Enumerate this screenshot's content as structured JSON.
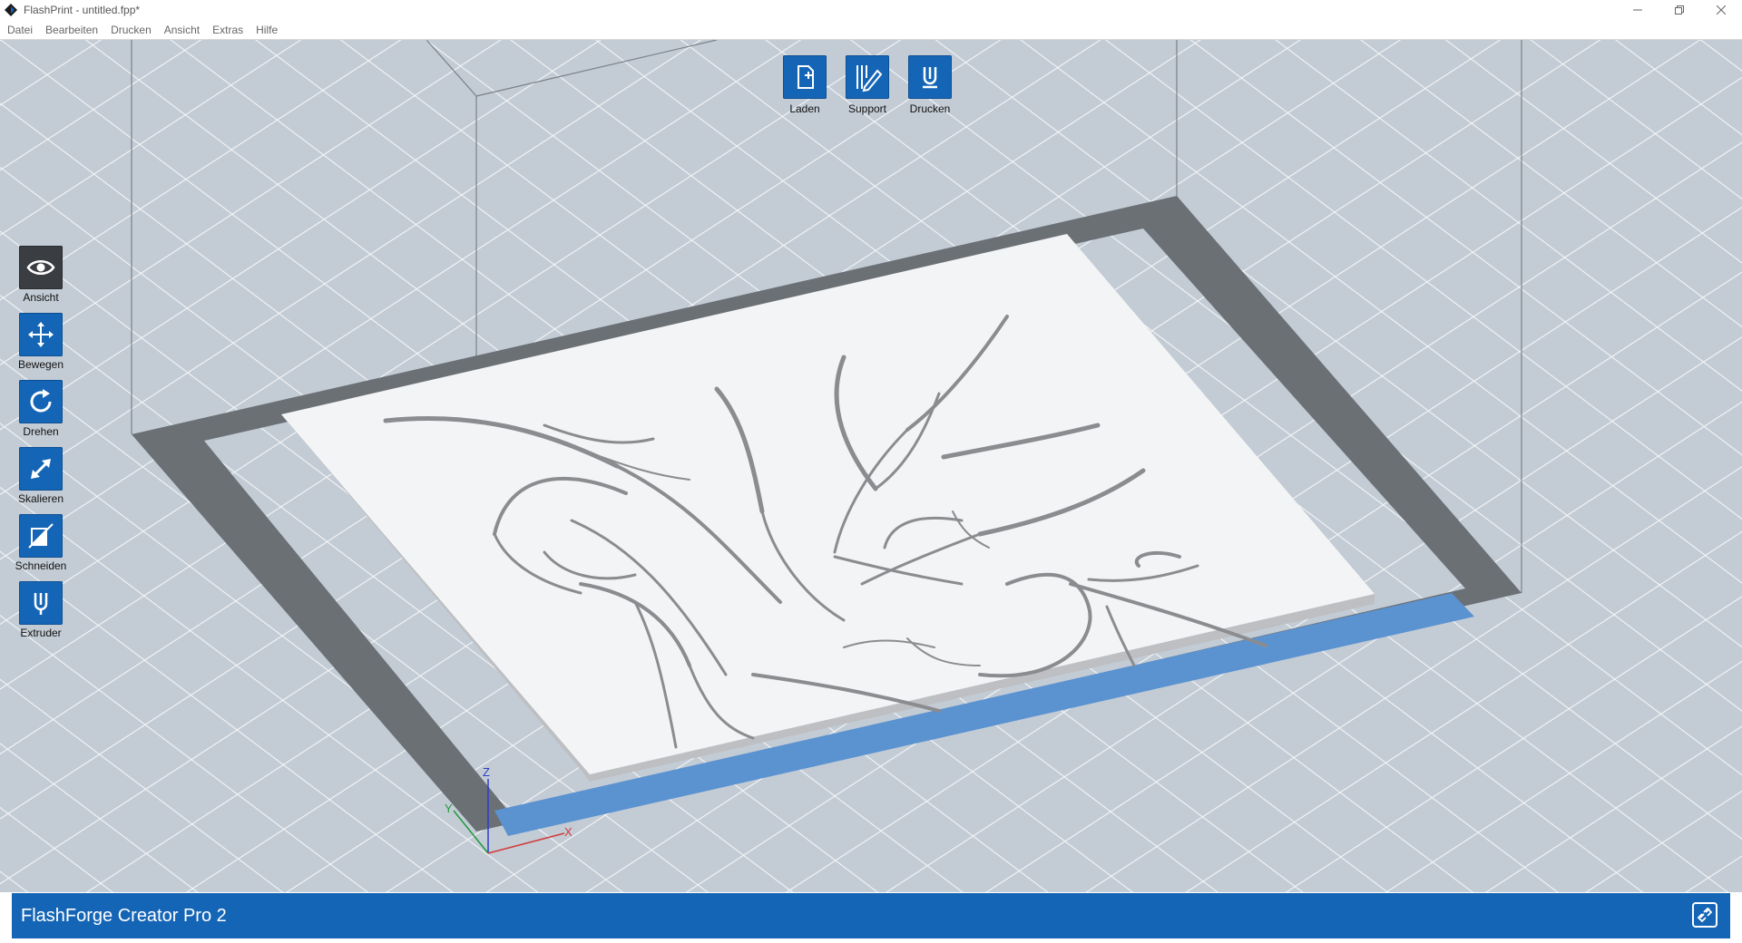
{
  "window": {
    "title": "FlashPrint - untitled.fpp*"
  },
  "menu": [
    {
      "label": "Datei"
    },
    {
      "label": "Bearbeiten"
    },
    {
      "label": "Drucken"
    },
    {
      "label": "Ansicht"
    },
    {
      "label": "Extras"
    },
    {
      "label": "Hilfe"
    }
  ],
  "top_toolbar": [
    {
      "label": "Laden",
      "icon": "file-add-icon"
    },
    {
      "label": "Support",
      "icon": "support-pencil-icon"
    },
    {
      "label": "Drucken",
      "icon": "print-nozzle-icon"
    }
  ],
  "left_toolbar": [
    {
      "label": "Ansicht",
      "icon": "eye-icon",
      "active": true
    },
    {
      "label": "Bewegen",
      "icon": "move-arrows-icon"
    },
    {
      "label": "Drehen",
      "icon": "rotate-icon"
    },
    {
      "label": "Skalieren",
      "icon": "scale-arrow-icon"
    },
    {
      "label": "Schneiden",
      "icon": "cut-icon"
    },
    {
      "label": "Extruder",
      "icon": "extruder-icon"
    }
  ],
  "axes": {
    "z": "Z",
    "x": "X",
    "y": "Y"
  },
  "status": {
    "printer": "FlashForge Creator Pro 2"
  },
  "colors": {
    "accent": "#1565b6",
    "viewport": "#c3ccd5",
    "platform_border": "#6b7075",
    "model": "#f2f3f4"
  }
}
